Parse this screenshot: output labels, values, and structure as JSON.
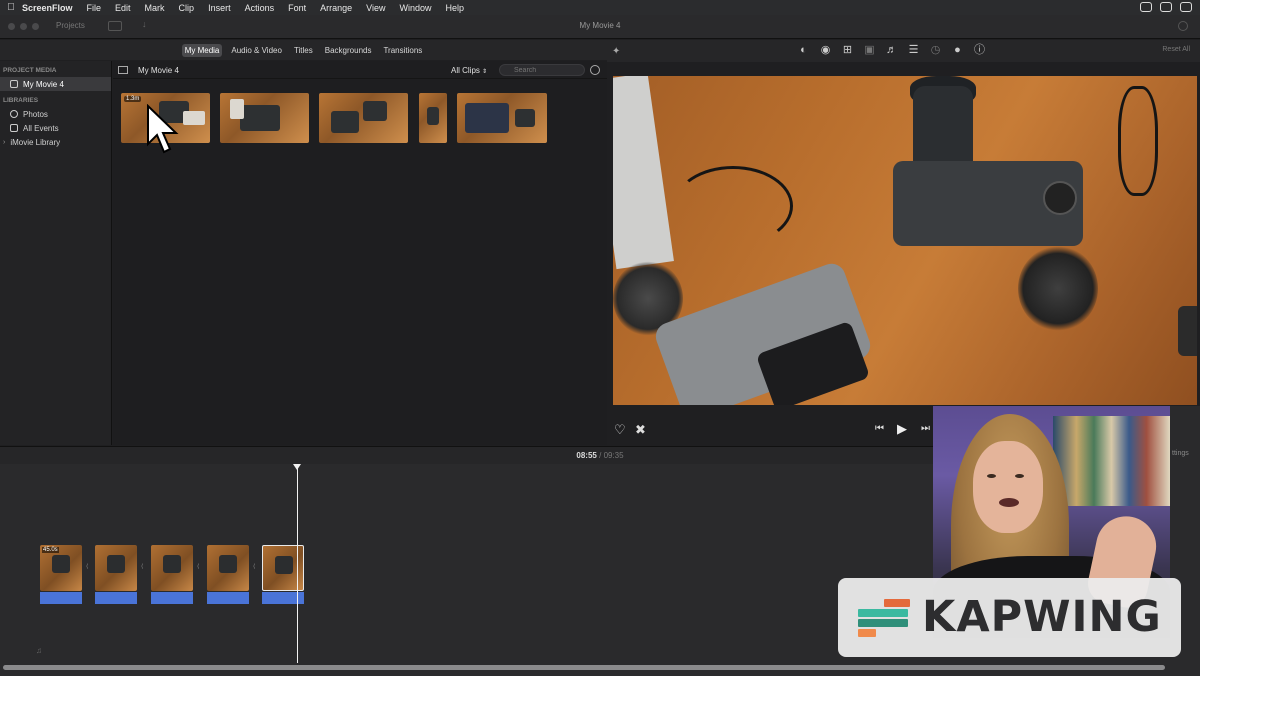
{
  "menubar": {
    "apple_icon": "apple-icon",
    "items": [
      "ScreenFlow",
      "File",
      "Edit",
      "Mark",
      "Clip",
      "Insert",
      "Actions",
      "Font",
      "Arrange",
      "View",
      "Window",
      "Help"
    ]
  },
  "window": {
    "title": "My Movie 4",
    "projects_button": "Projects"
  },
  "browser_tabs": [
    "My Media",
    "Audio & Video",
    "Titles",
    "Backgrounds",
    "Transitions"
  ],
  "sidebar": {
    "project_media_header": "PROJECT MEDIA",
    "project_item": "My Movie 4",
    "libraries_header": "LIBRARIES",
    "photos": "Photos",
    "all_events": "All Events",
    "imovie_library": "iMovie Library"
  },
  "media": {
    "project_title": "My Movie 4",
    "filter": "All Clips",
    "search_placeholder": "Search",
    "first_clip_duration": "1.3m"
  },
  "viewer": {
    "reset_all": "Reset All",
    "tools": [
      "color-balance-icon",
      "color-correction-icon",
      "crop-icon",
      "stabilization-icon",
      "volume-icon",
      "noise-reduction-icon",
      "speed-icon",
      "filter-icon",
      "info-icon"
    ]
  },
  "timeline": {
    "current_time": "08:55",
    "separator": "/",
    "total_time": "09:35",
    "first_clip_duration": "45.0s"
  },
  "inspector": {
    "label": "ttings"
  },
  "watermark": {
    "text": "KAPWING",
    "colors": {
      "bar1": "#e46a3c",
      "bar2": "#3ab9a0",
      "bar3": "#2f8f7a",
      "bar4": "#f08a4b"
    }
  },
  "colors": {
    "app_background": "#1f1f21",
    "playhead": "#f2f2f2",
    "audio_wave": "#3a63c9"
  }
}
